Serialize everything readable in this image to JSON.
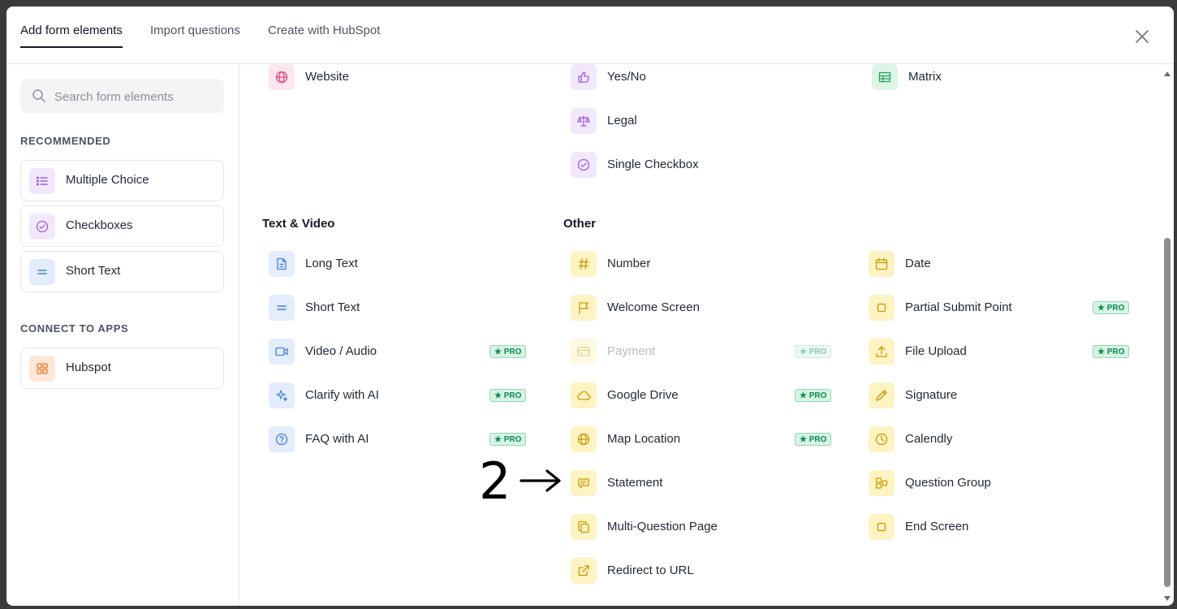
{
  "tabs": [
    {
      "label": "Add form elements",
      "active": true
    },
    {
      "label": "Import questions",
      "active": false
    },
    {
      "label": "Create with HubSpot",
      "active": false
    }
  ],
  "search": {
    "placeholder": "Search form elements",
    "value": ""
  },
  "sidebar": {
    "recommended_title": "RECOMMENDED",
    "recommended": [
      {
        "label": "Multiple Choice",
        "icon": "list-icon"
      },
      {
        "label": "Checkboxes",
        "icon": "check-circle-icon"
      },
      {
        "label": "Short Text",
        "icon": "equals-icon"
      }
    ],
    "connect_title": "CONNECT TO APPS",
    "apps": [
      {
        "label": "Hubspot",
        "icon": "grid-icon"
      }
    ]
  },
  "main": {
    "top_row": {
      "website": "Website",
      "yesno": "Yes/No",
      "legal": "Legal",
      "single_checkbox": "Single Checkbox",
      "matrix": "Matrix"
    },
    "text_video_title": "Text & Video",
    "text_video": [
      {
        "label": "Long Text",
        "icon": "document-icon",
        "pro": false
      },
      {
        "label": "Short Text",
        "icon": "equals-icon",
        "pro": false
      },
      {
        "label": "Video / Audio",
        "icon": "video-icon",
        "pro": true
      },
      {
        "label": "Clarify with AI",
        "icon": "sparkle-icon",
        "pro": true
      },
      {
        "label": "FAQ with AI",
        "icon": "question-circle-icon",
        "pro": true
      }
    ],
    "other_title": "Other",
    "other_col1": [
      {
        "label": "Number",
        "icon": "hash-icon",
        "pro": false
      },
      {
        "label": "Welcome Screen",
        "icon": "flag-icon",
        "pro": false
      },
      {
        "label": "Payment",
        "icon": "card-icon",
        "pro": true,
        "disabled": true
      },
      {
        "label": "Google Drive",
        "icon": "cloud-icon",
        "pro": true
      },
      {
        "label": "Map Location",
        "icon": "globe-icon",
        "pro": true
      },
      {
        "label": "Statement",
        "icon": "speech-bubble-icon",
        "pro": false
      },
      {
        "label": "Multi-Question Page",
        "icon": "copy-icon",
        "pro": false
      },
      {
        "label": "Redirect to URL",
        "icon": "external-link-icon",
        "pro": false
      }
    ],
    "other_col2": [
      {
        "label": "Date",
        "icon": "calendar-icon",
        "pro": false
      },
      {
        "label": "Partial Submit Point",
        "icon": "square-icon",
        "pro": true
      },
      {
        "label": "File Upload",
        "icon": "upload-icon",
        "pro": true
      },
      {
        "label": "Signature",
        "icon": "pen-icon",
        "pro": false
      },
      {
        "label": "Calendly",
        "icon": "clock-icon",
        "pro": false
      },
      {
        "label": "Question Group",
        "icon": "group-icon",
        "pro": false
      },
      {
        "label": "End Screen",
        "icon": "square-icon",
        "pro": false
      }
    ],
    "pro_badge": "★ PRO"
  },
  "annotation": {
    "number": "2",
    "arrow": "→"
  },
  "colors": {
    "purple": "#9b5de5",
    "blue": "#4a7fd6",
    "yellow": "#c99a00",
    "pro_green": "#0e8a55"
  }
}
